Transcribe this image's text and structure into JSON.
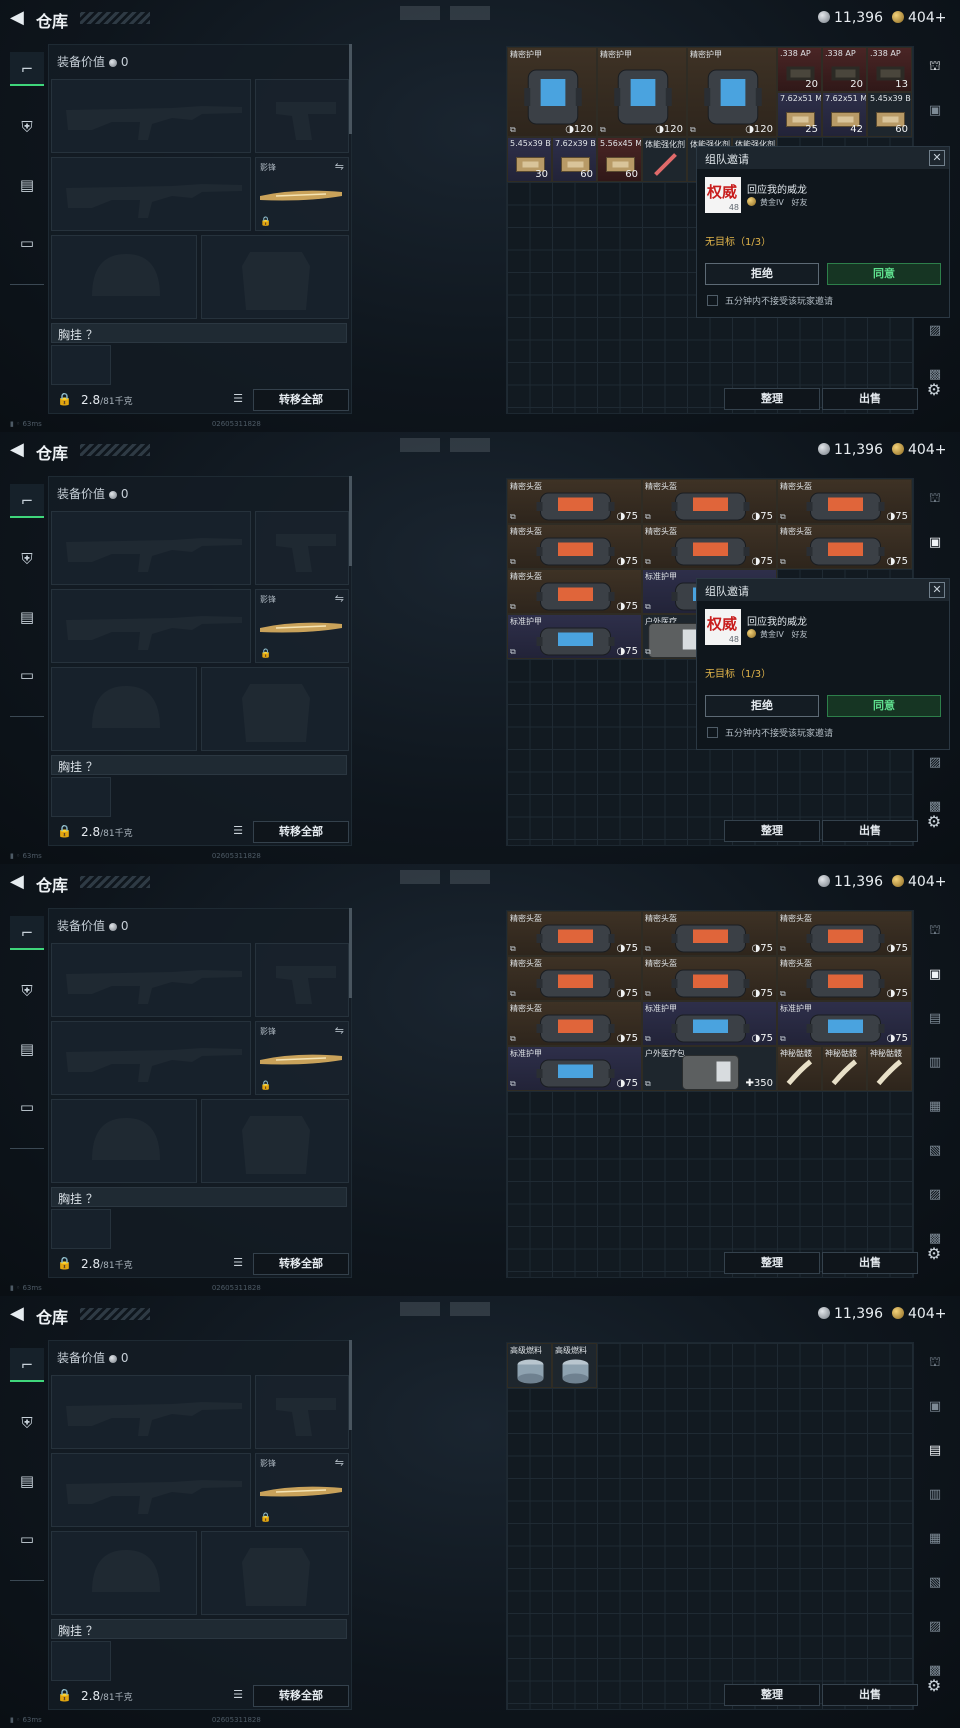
{
  "header": {
    "title": "仓库",
    "silver": "11,396",
    "gold": "404+"
  },
  "loadout": {
    "value_label": "装备价值",
    "value": "0",
    "knife_label": "影锋",
    "chest_label": "胸挂 ？",
    "weight": "2.8",
    "weight_unit": "/81千克",
    "transfer_all": "转移全部"
  },
  "actions": {
    "sort": "整理",
    "sell": "出售"
  },
  "footer": {
    "ping": "63ms",
    "uid": "02605311828"
  },
  "popup": {
    "title": "组队邀请",
    "avatar_text": "权威",
    "avatar_level": "48",
    "player": "回应我的威龙",
    "rank": "黄金IV",
    "relation": "好友",
    "target": "无目标（1/3）",
    "reject": "拒绝",
    "accept": "同意",
    "option": "五分钟内不接受该玩家邀请"
  },
  "frames": [
    {
      "popup": true,
      "items": [
        {
          "name": "精密护甲",
          "val": "◑120",
          "kind": "bag",
          "color": "brown",
          "c": 0,
          "r": 0,
          "w": 4,
          "h": 4,
          "icon": "#4aa3df"
        },
        {
          "name": "精密护甲",
          "val": "◑120",
          "kind": "bag",
          "color": "brown",
          "c": 4,
          "r": 0,
          "w": 4,
          "h": 4,
          "icon": "#4aa3df"
        },
        {
          "name": "精密护甲",
          "val": "◑120",
          "kind": "bag",
          "color": "brown",
          "c": 8,
          "r": 0,
          "w": 4,
          "h": 4,
          "icon": "#4aa3df"
        },
        {
          "name": ".338 AP",
          "val": "20",
          "kind": "ammo",
          "color": "red",
          "c": 12,
          "r": 0,
          "w": 2,
          "h": 2
        },
        {
          "name": ".338 AP",
          "val": "20",
          "kind": "ammo",
          "color": "red",
          "c": 14,
          "r": 0,
          "w": 2,
          "h": 2
        },
        {
          "name": ".338 AP",
          "val": "13",
          "kind": "ammo",
          "color": "red",
          "c": 16,
          "r": 0,
          "w": 2,
          "h": 2
        },
        {
          "name": "7.62x51 M61",
          "val": "25",
          "kind": "box",
          "color": "purple",
          "c": 12,
          "r": 2,
          "w": 2,
          "h": 2
        },
        {
          "name": "7.62x51 M80",
          "val": "42",
          "kind": "box",
          "color": "purple",
          "c": 14,
          "r": 2,
          "w": 2,
          "h": 2
        },
        {
          "name": "5.45x39 BS",
          "val": "60",
          "kind": "box",
          "color": "grey",
          "c": 16,
          "r": 2,
          "w": 2,
          "h": 2
        },
        {
          "name": "5.45x39 BT",
          "val": "30",
          "kind": "box",
          "color": "purple",
          "c": 0,
          "r": 4,
          "w": 2,
          "h": 2
        },
        {
          "name": "7.62x39 BP",
          "val": "60",
          "kind": "box",
          "color": "purple",
          "c": 2,
          "r": 4,
          "w": 2,
          "h": 2
        },
        {
          "name": "5.56x45 M855A1",
          "val": "60",
          "kind": "box",
          "color": "red",
          "c": 4,
          "r": 4,
          "w": 2,
          "h": 2
        },
        {
          "name": "体能强化剂",
          "val": "",
          "kind": "syringe",
          "color": "grey",
          "c": 6,
          "r": 4,
          "w": 2,
          "h": 2
        },
        {
          "name": "体能强化剂",
          "val": "",
          "kind": "syringe",
          "color": "grey",
          "c": 8,
          "r": 4,
          "w": 2,
          "h": 2
        },
        {
          "name": "体能强化剂",
          "val": "",
          "kind": "syringe",
          "color": "grey",
          "c": 10,
          "r": 4,
          "w": 2,
          "h": 2
        }
      ]
    },
    {
      "popup": true,
      "items": [
        {
          "name": "精密头盔",
          "val": "◑75",
          "kind": "bag",
          "color": "brown",
          "c": 0,
          "r": 0,
          "w": 6,
          "h": 2,
          "icon": "#e0653a"
        },
        {
          "name": "精密头盔",
          "val": "◑75",
          "kind": "bag",
          "color": "brown",
          "c": 6,
          "r": 0,
          "w": 6,
          "h": 2,
          "icon": "#e0653a"
        },
        {
          "name": "精密头盔",
          "val": "◑75",
          "kind": "bag",
          "color": "brown",
          "c": 12,
          "r": 0,
          "w": 6,
          "h": 2,
          "icon": "#e0653a"
        },
        {
          "name": "精密头盔",
          "val": "◑75",
          "kind": "bag",
          "color": "brown",
          "c": 0,
          "r": 2,
          "w": 6,
          "h": 2,
          "icon": "#e0653a"
        },
        {
          "name": "精密头盔",
          "val": "◑75",
          "kind": "bag",
          "color": "brown",
          "c": 6,
          "r": 2,
          "w": 6,
          "h": 2,
          "icon": "#e0653a"
        },
        {
          "name": "精密头盔",
          "val": "◑75",
          "kind": "bag",
          "color": "brown",
          "c": 12,
          "r": 2,
          "w": 6,
          "h": 2,
          "icon": "#e0653a"
        },
        {
          "name": "精密头盔",
          "val": "◑75",
          "kind": "bag",
          "color": "brown",
          "c": 0,
          "r": 4,
          "w": 6,
          "h": 2,
          "icon": "#e0653a"
        },
        {
          "name": "标准护甲",
          "val": "",
          "kind": "bag",
          "color": "purple",
          "c": 6,
          "r": 4,
          "w": 6,
          "h": 2,
          "icon": "#4aa3df"
        },
        {
          "name": "标准护甲",
          "val": "◑75",
          "kind": "bag",
          "color": "purple",
          "c": 0,
          "r": 6,
          "w": 6,
          "h": 2,
          "icon": "#4aa3df"
        },
        {
          "name": "户外医疗",
          "val": "",
          "kind": "kit",
          "color": "grey",
          "c": 6,
          "r": 6,
          "w": 3,
          "h": 2
        }
      ]
    },
    {
      "popup": false,
      "items": [
        {
          "name": "精密头盔",
          "val": "◑75",
          "kind": "bag",
          "color": "brown",
          "c": 0,
          "r": 0,
          "w": 6,
          "h": 2,
          "icon": "#e0653a"
        },
        {
          "name": "精密头盔",
          "val": "◑75",
          "kind": "bag",
          "color": "brown",
          "c": 6,
          "r": 0,
          "w": 6,
          "h": 2,
          "icon": "#e0653a"
        },
        {
          "name": "精密头盔",
          "val": "◑75",
          "kind": "bag",
          "color": "brown",
          "c": 12,
          "r": 0,
          "w": 6,
          "h": 2,
          "icon": "#e0653a"
        },
        {
          "name": "精密头盔",
          "val": "◑75",
          "kind": "bag",
          "color": "brown",
          "c": 0,
          "r": 2,
          "w": 6,
          "h": 2,
          "icon": "#e0653a"
        },
        {
          "name": "精密头盔",
          "val": "◑75",
          "kind": "bag",
          "color": "brown",
          "c": 6,
          "r": 2,
          "w": 6,
          "h": 2,
          "icon": "#e0653a"
        },
        {
          "name": "精密头盔",
          "val": "◑75",
          "kind": "bag",
          "color": "brown",
          "c": 12,
          "r": 2,
          "w": 6,
          "h": 2,
          "icon": "#e0653a"
        },
        {
          "name": "精密头盔",
          "val": "◑75",
          "kind": "bag",
          "color": "brown",
          "c": 0,
          "r": 4,
          "w": 6,
          "h": 2,
          "icon": "#e0653a"
        },
        {
          "name": "标准护甲",
          "val": "◑75",
          "kind": "bag",
          "color": "purple",
          "c": 6,
          "r": 4,
          "w": 6,
          "h": 2,
          "icon": "#4aa3df"
        },
        {
          "name": "标准护甲",
          "val": "◑75",
          "kind": "bag",
          "color": "purple",
          "c": 12,
          "r": 4,
          "w": 6,
          "h": 2,
          "icon": "#4aa3df"
        },
        {
          "name": "标准护甲",
          "val": "◑75",
          "kind": "bag",
          "color": "purple",
          "c": 0,
          "r": 6,
          "w": 6,
          "h": 2,
          "icon": "#4aa3df"
        },
        {
          "name": "户外医疗包",
          "val": "✚350",
          "kind": "kit",
          "color": "grey",
          "c": 6,
          "r": 6,
          "w": 6,
          "h": 2
        },
        {
          "name": "神秘骷髅",
          "val": "",
          "kind": "bone",
          "color": "brown",
          "c": 12,
          "r": 6,
          "w": 2,
          "h": 2
        },
        {
          "name": "神秘骷髅",
          "val": "",
          "kind": "bone",
          "color": "brown",
          "c": 14,
          "r": 6,
          "w": 2,
          "h": 2
        },
        {
          "name": "神秘骷髅",
          "val": "",
          "kind": "bone",
          "color": "brown",
          "c": 16,
          "r": 6,
          "w": 2,
          "h": 2
        }
      ]
    },
    {
      "popup": false,
      "items": [
        {
          "name": "高级燃料",
          "val": "",
          "kind": "can",
          "color": "grey",
          "c": 0,
          "r": 0,
          "w": 2,
          "h": 2
        },
        {
          "name": "高级燃料",
          "val": "",
          "kind": "can",
          "color": "grey",
          "c": 2,
          "r": 0,
          "w": 2,
          "h": 2
        }
      ]
    }
  ]
}
